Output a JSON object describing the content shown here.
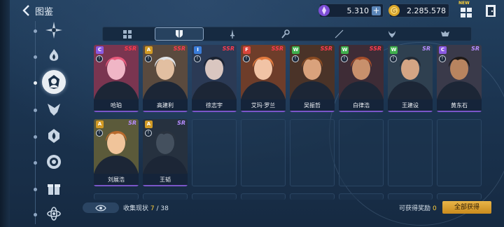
{
  "header": {
    "title": "图鉴"
  },
  "resources": {
    "gems": {
      "value": "5.310",
      "icon": "crystal-icon"
    },
    "coins": {
      "value": "2.285.578",
      "icon": "coin-icon"
    }
  },
  "top_buttons": {
    "new_badge": "NEW"
  },
  "tabs": [
    {
      "name": "grid"
    },
    {
      "name": "shield"
    },
    {
      "name": "sword"
    },
    {
      "name": "staff"
    },
    {
      "name": "blade"
    },
    {
      "name": "horn"
    },
    {
      "name": "beast"
    }
  ],
  "cards": [
    {
      "name": "哈珀",
      "rarity": "SSR",
      "element": "C",
      "elem_color": "#8a59e0",
      "skin": "#f0b6c6",
      "hair": "#e85a7c",
      "bg": "#7a3550"
    },
    {
      "name": "高建利",
      "rarity": "SSR",
      "element": "A",
      "elem_color": "#d19a25",
      "skin": "#e2bfa1",
      "hair": "#dfe2e6",
      "bg": "#5a4a3e"
    },
    {
      "name": "徐志宇",
      "rarity": "SSR",
      "element": "I",
      "elem_color": "#3a7cd8",
      "skin": "#d9c6c0",
      "hair": "#1b2230",
      "bg": "#2b3a55"
    },
    {
      "name": "艾玛·罗兰",
      "rarity": "SSR",
      "element": "F",
      "elem_color": "#d9453b",
      "skin": "#f1c3a5",
      "hair": "#e27a3e",
      "bg": "#6e3d2a"
    },
    {
      "name": "吴振哲",
      "rarity": "SSR",
      "element": "W",
      "elem_color": "#3fae4c",
      "skin": "#d9a27c",
      "hair": "#8a4b22",
      "bg": "#4a3328"
    },
    {
      "name": "白律浩",
      "rarity": "SSR",
      "element": "W",
      "elem_color": "#3fae4c",
      "skin": "#c8906c",
      "hair": "#a34d2a",
      "bg": "#3e2c36"
    },
    {
      "name": "王建设",
      "rarity": "SR",
      "element": "W",
      "elem_color": "#3fae4c",
      "skin": "#d4a584",
      "hair": "#222a35",
      "bg": "#2f4050"
    },
    {
      "name": "黄东石",
      "rarity": "SR",
      "element": "C",
      "elem_color": "#8a59e0",
      "skin": "#b8845f",
      "hair": "#1f1a18",
      "bg": "#3a3a4a"
    },
    {
      "name": "刘展浩",
      "rarity": "SR",
      "element": "A",
      "elem_color": "#d19a25",
      "skin": "#f0c49a",
      "hair": "#b86a2c",
      "bg": "#5b5a3a"
    },
    {
      "name": "王韬",
      "rarity": "SR",
      "element": "A",
      "elem_color": "#d19a25",
      "skin": "#44505e",
      "hair": "#2a333f",
      "bg": "#26313f"
    }
  ],
  "footer": {
    "collect_label": "收集现状",
    "collect_current": "7",
    "collect_total": "/ 38",
    "reward_label": "可获得奖励",
    "reward_count": "0",
    "claim_all": "全部获得"
  }
}
